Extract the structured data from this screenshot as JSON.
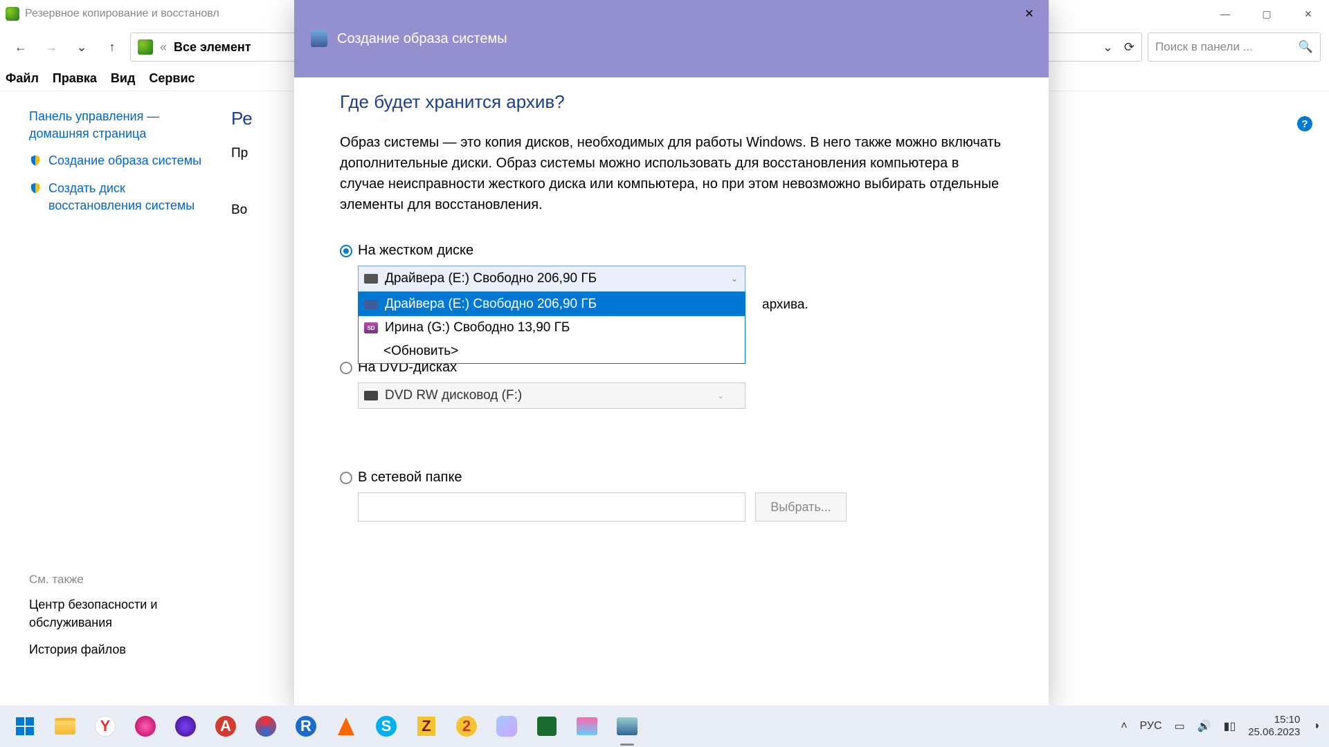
{
  "window": {
    "title": "Резервное копирование и восстановл",
    "controls": {
      "min": "—",
      "max": "▢",
      "close": "✕"
    }
  },
  "toolbar": {
    "breadcrumb_all": "Все элемент",
    "search_placeholder": "Поиск в панели ...",
    "back": "←",
    "fwd": "→",
    "drop": "⌄",
    "up": "↑",
    "refresh": "⟳"
  },
  "menubar": {
    "file": "Файл",
    "edit": "Правка",
    "view": "Вид",
    "service": "Сервис"
  },
  "sidebar": {
    "home": "Панель управления — домашняя страница",
    "create_image": "Создание образа системы",
    "create_recovery": "Создать диск восстановления системы",
    "see_also_title": "См. также",
    "security_center": "Центр безопасности и обслуживания",
    "file_history": "История файлов"
  },
  "main": {
    "heading_cut": "Ре",
    "line_pr": "Пр",
    "line_vo": "Во"
  },
  "dialog": {
    "title": "Создание образа системы",
    "close": "✕",
    "heading": "Где будет хранится архив?",
    "body_text": "Образ системы — это копия дисков, необходимых для работы Windows. В него также можно включать дополнительные диски. Образ системы можно использовать для восстановления компьютера в случае неисправности жесткого диска или компьютера, но при этом невозможно выбирать отдельные элементы для восстановления.",
    "opt_hdd": "На жестком диске",
    "combo_selected": "Драйвера (E:)  Свободно 206,90 ГБ",
    "dd_item1": "Драйвера (E:)  Свободно 206,90 ГБ",
    "dd_item2": "Ирина (G:)  Свободно 13,90 ГБ",
    "dd_refresh": "<Обновить>",
    "archive_hint_tail": "архива.",
    "opt_dvd": "На DVD-дисках",
    "dvd_selected": "DVD RW дисковод (F:)",
    "opt_net": "В сетевой папке",
    "choose_btn": "Выбрать..."
  },
  "taskbar": {
    "lang": "РУС",
    "time": "15:10",
    "date": "25.06.2023"
  }
}
